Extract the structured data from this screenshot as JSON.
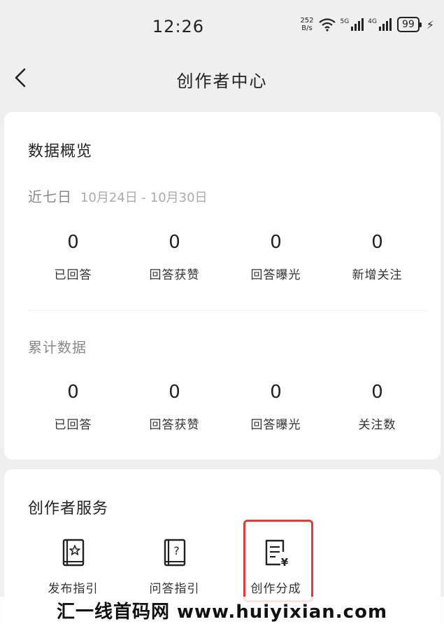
{
  "status_bar": {
    "time": "12:26",
    "net_speed_value": "252",
    "net_speed_unit": "B/s",
    "signal1_label": "5G",
    "signal2_label": "4G",
    "battery": "99"
  },
  "nav": {
    "title": "创作者中心"
  },
  "overview": {
    "title": "数据概览",
    "recent": {
      "label": "近七日",
      "date_range": "10月24日 - 10月30日",
      "stats": [
        {
          "value": "0",
          "label": "已回答"
        },
        {
          "value": "0",
          "label": "回答获赞"
        },
        {
          "value": "0",
          "label": "回答曝光"
        },
        {
          "value": "0",
          "label": "新增关注"
        }
      ]
    },
    "cumulative": {
      "label": "累计数据",
      "stats": [
        {
          "value": "0",
          "label": "已回答"
        },
        {
          "value": "0",
          "label": "回答获赞"
        },
        {
          "value": "0",
          "label": "回答曝光"
        },
        {
          "value": "0",
          "label": "关注数"
        }
      ]
    }
  },
  "services": {
    "title": "创作者服务",
    "items": [
      {
        "label": "发布指引",
        "icon": "book-star-icon"
      },
      {
        "label": "问答指引",
        "icon": "book-question-icon"
      },
      {
        "label": "创作分成",
        "icon": "document-yen-icon"
      }
    ],
    "highlight_color": "#e53935"
  },
  "watermark": {
    "text": "汇一线首码网 www.huiyixian.com"
  }
}
